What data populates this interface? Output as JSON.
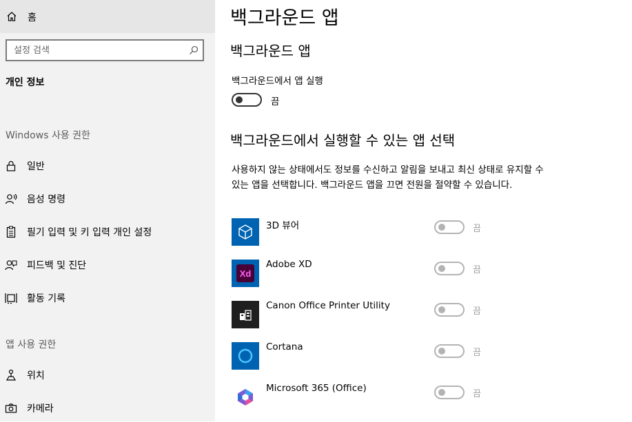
{
  "sidebar": {
    "home_label": "홈",
    "search_placeholder": "설정 검색",
    "section_title": "개인 정보",
    "windows_group": "Windows 사용 권한",
    "windows_items": [
      {
        "label": "일반",
        "icon": "lock-icon"
      },
      {
        "label": "음성 명령",
        "icon": "speech-icon"
      },
      {
        "label": "필기 입력 및 키 입력 개인 설정",
        "icon": "clipboard-icon"
      },
      {
        "label": "피드백 및 진단",
        "icon": "feedback-icon"
      },
      {
        "label": "활동 기록",
        "icon": "timeline-icon"
      }
    ],
    "app_group": "앱 사용 권한",
    "app_items": [
      {
        "label": "위치",
        "icon": "location-icon"
      },
      {
        "label": "카메라",
        "icon": "camera-icon"
      }
    ]
  },
  "main": {
    "page_title": "백그라운드 앱",
    "sub_title": "백그라운드 앱",
    "run_label": "백그라운드에서 앱 실행",
    "run_state": "끔",
    "select_title": "백그라운드에서 실행할 수 있는 앱 선택",
    "description": "사용하지 않는 상태에서도 정보를 수신하고 알림을 보내고 최신 상태로 유지할 수 있는 앱을 선택합니다. 백그라운드 앱을 끄면 전원을 절약할 수 있습니다.",
    "apps": [
      {
        "name": "3D 뷰어",
        "state": "끔",
        "icon": "3d-viewer-icon",
        "color": "#0063b1"
      },
      {
        "name": "Adobe XD",
        "state": "끔",
        "icon": "adobe-xd-icon",
        "color": "#0063b1"
      },
      {
        "name": "Canon Office Printer Utility",
        "state": "끔",
        "icon": "canon-printer-icon",
        "color": "#1f1f1f"
      },
      {
        "name": "Cortana",
        "state": "끔",
        "icon": "cortana-icon",
        "color": "#0063b1"
      },
      {
        "name": "Microsoft 365 (Office)",
        "state": "끔",
        "icon": "office-icon",
        "color": "#ffffff"
      }
    ]
  },
  "colors": {
    "sidebar_bg": "#f2f2f2",
    "home_bg": "#e6e6e6",
    "tile_blue": "#0063b1",
    "xd_purple": "#ff61f6"
  }
}
